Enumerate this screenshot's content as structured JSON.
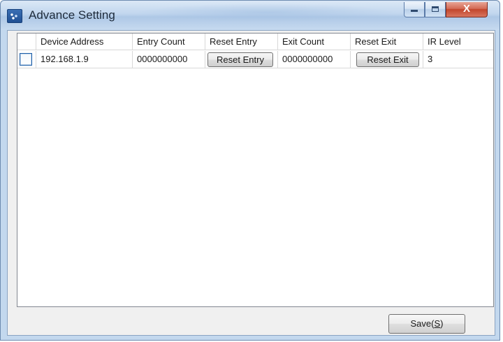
{
  "window": {
    "title": "Advance Setting",
    "close_symbol": "X",
    "icons": {
      "app": "app-icon",
      "minimize": "minimize-icon",
      "maximize": "maximize-icon",
      "close": "close-icon"
    }
  },
  "table": {
    "columns": [
      "Device Address",
      "Entry Count",
      "Reset Entry",
      "Exit Count",
      "Reset Exit",
      "IR Level"
    ],
    "rows": [
      {
        "checked": false,
        "device_address": "192.168.1.9",
        "entry_count": "0000000000",
        "reset_entry_label": "Reset Entry",
        "exit_count": "0000000000",
        "reset_exit_label": "Reset Exit",
        "ir_level": "3"
      }
    ]
  },
  "footer": {
    "save_label_prefix": "Save(",
    "save_label_mnemonic": "S",
    "save_label_suffix": ")"
  }
}
